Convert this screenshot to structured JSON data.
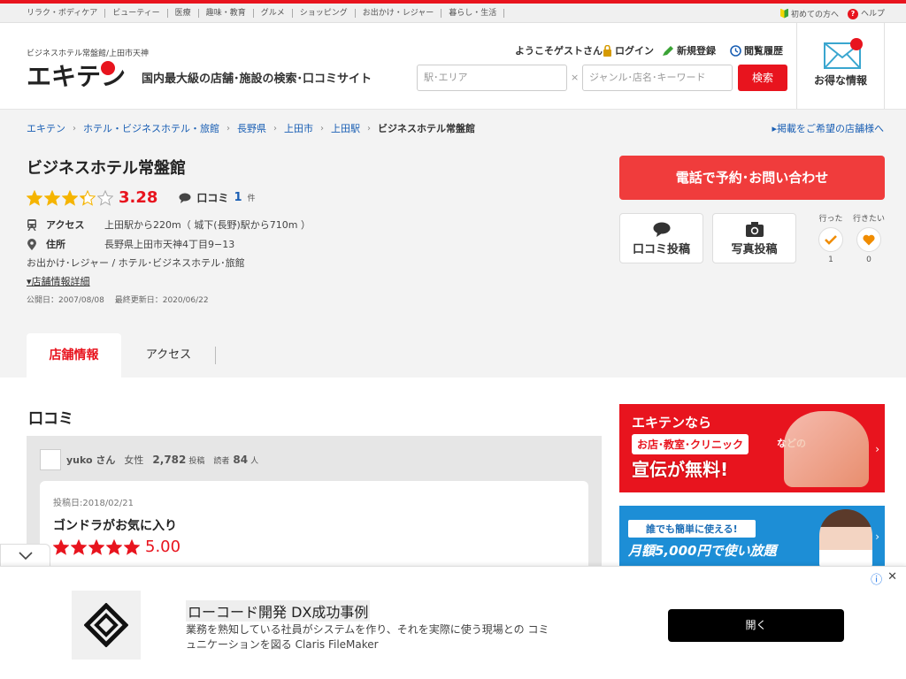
{
  "categories": [
    "リラク・ボディケア",
    "ビューティー",
    "医療",
    "趣味・教育",
    "グルメ",
    "ショッピング",
    "お出かけ・レジャー",
    "暮らし・生活"
  ],
  "top_links": {
    "beginner": "初めての方へ",
    "help": "ヘルプ"
  },
  "header": {
    "logo_sub": "ビジネスホテル常盤館/上田市天神",
    "logo_text": "エキテン",
    "tagline": "国内最大級の店舗･施設の検索･口コミサイト",
    "welcome": "ようこそゲストさん",
    "login": "ログイン",
    "register": "新規登録",
    "history": "閲覧履歴",
    "search_area_placeholder": "駅･エリア",
    "search_x": "×",
    "search_keyword_placeholder": "ジャンル･店名･キーワード",
    "search_button": "検索",
    "deals": "お得な情報"
  },
  "breadcrumb": {
    "items": [
      "エキテン",
      "ホテル・ビジネスホテル・旅館",
      "長野県",
      "上田市",
      "上田駅"
    ],
    "current": "ビジネスホテル常盤館",
    "right_link": "掲載をご希望の店舗様へ"
  },
  "shop": {
    "name": "ビジネスホテル常盤館",
    "rating": "3.28",
    "rating_value": 3.28,
    "kuchikomi_label": "口コミ",
    "kuchikomi_count": "1",
    "kuchikomi_unit": "件",
    "access_label": "アクセス",
    "access_value": "上田駅から220m（ 城下(長野)駅から710m ）",
    "address_label": "住所",
    "address_value": "長野県上田市天神4丁目9−13",
    "genre": "お出かけ･レジャー /  ホテル･ビジネスホテル･旅館",
    "details_link": "店舗情報詳細",
    "dates": "公開日：2007/08/08　 最終更新日：2020/06/22"
  },
  "actions": {
    "call": "電話で予約･お問い合わせ",
    "review_post": "口コミ投稿",
    "photo_post": "写真投稿",
    "went_label": "行った",
    "went_count": "1",
    "want_label": "行きたい",
    "want_count": "0"
  },
  "tabs": {
    "active": "店舗情報",
    "other": "アクセス"
  },
  "reviews": {
    "section_title": "口コミ",
    "reviewer_name": "yuko さん",
    "gender": "女性",
    "posts_count": "2,782",
    "posts_label": "投稿",
    "readers_label": "読者",
    "readers_count": "84",
    "readers_unit": "人",
    "post_date": "投稿日:2018/02/21",
    "title": "ゴンドラがお気に入り",
    "rating": "5.00",
    "rating_value": 5.0
  },
  "side_ads": {
    "ad1_line1": "エキテンなら",
    "ad1_line2": "お店･教室･クリニック",
    "ad1_line2b": "などの",
    "ad1_line3": "宣伝が無料!",
    "ad2_line1": "誰でも簡単に使える!",
    "ad2_line2": "月額5,000円で使い放題"
  },
  "bottom_ad": {
    "headline": "ローコード開発 DX成功事例",
    "body": "業務を熟知している社員がシステムを作り、それを実際に使う現場との コミュニケーションを図る Claris FileMaker",
    "button": "開く"
  },
  "colors": {
    "brand_red": "#e8141e",
    "star_gold": "#f5b400",
    "review_star": "#e8141e",
    "link_blue": "#1a5fb4"
  }
}
